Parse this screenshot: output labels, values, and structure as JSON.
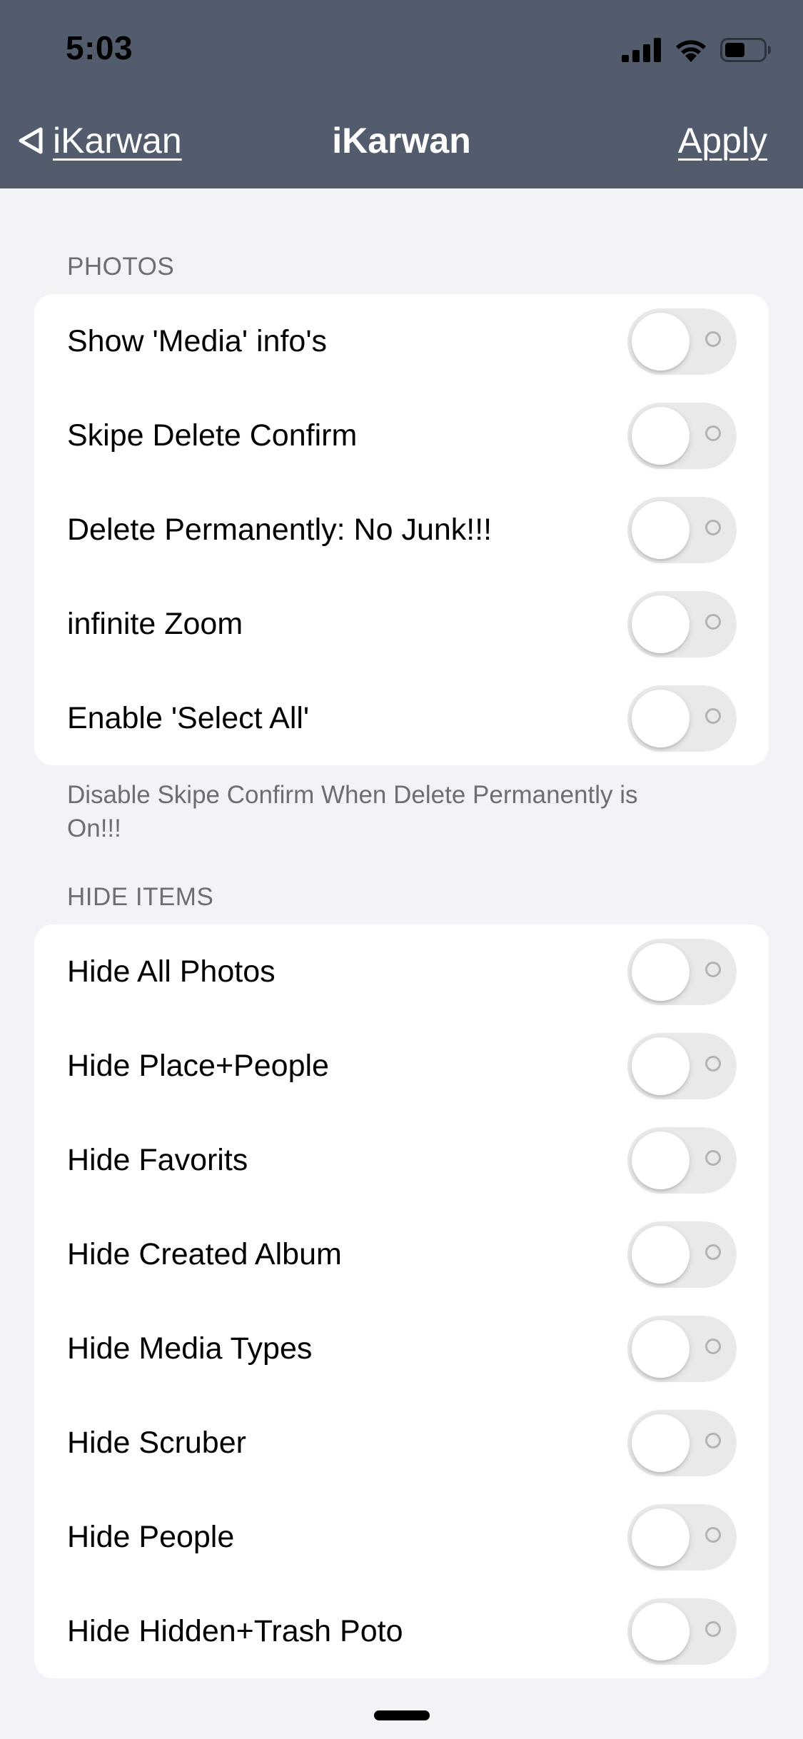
{
  "status_bar": {
    "time": "5:03",
    "icons": [
      "cellular-signal-icon",
      "wifi-icon",
      "battery-icon"
    ]
  },
  "nav": {
    "back_label": "iKarwan",
    "title": "iKarwan",
    "apply_label": "Apply"
  },
  "sections": [
    {
      "header": "PHOTOS",
      "rows": [
        {
          "label": "Show 'Media' info's",
          "on": false
        },
        {
          "label": "Skipe Delete Confirm",
          "on": false
        },
        {
          "label": "Delete Permanently: No Junk!!!",
          "on": false
        },
        {
          "label": "infinite Zoom",
          "on": false
        },
        {
          "label": "Enable 'Select All'",
          "on": false
        }
      ],
      "footer": "Disable Skipe Confirm When Delete Permanently is On!!!"
    },
    {
      "header": "HIDE ITEMS",
      "rows": [
        {
          "label": "Hide All Photos",
          "on": false
        },
        {
          "label": "Hide Place+People",
          "on": false
        },
        {
          "label": "Hide Favorits",
          "on": false
        },
        {
          "label": "Hide Created Album",
          "on": false
        },
        {
          "label": "Hide Media Types",
          "on": false
        },
        {
          "label": "Hide Scruber",
          "on": false
        },
        {
          "label": "Hide People",
          "on": false
        },
        {
          "label": "Hide Hidden+Trash Poto",
          "on": false
        }
      ]
    }
  ],
  "colors": {
    "nav_background": "#525c6c",
    "page_background": "#f2f2f7",
    "toggle_off": "#e9e9ea"
  }
}
